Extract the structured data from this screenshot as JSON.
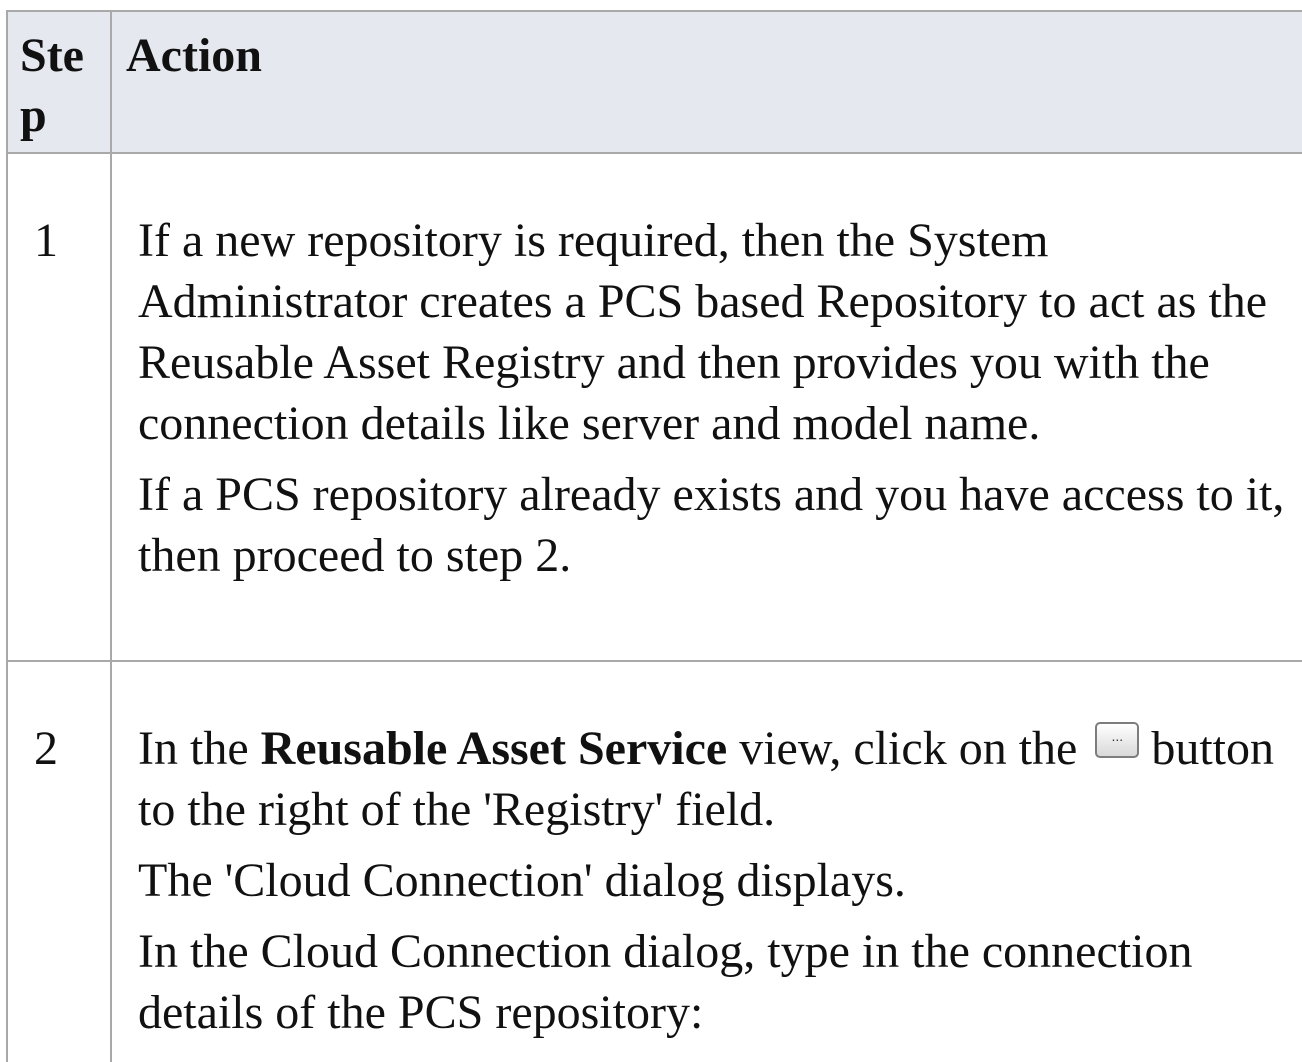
{
  "table": {
    "header": {
      "step": "Step",
      "action": "Action"
    },
    "rows": [
      {
        "step": "1",
        "paragraphs": [
          "If a new repository is required, then the System Administrator creates a PCS based Repository to act as the Reusable Asset Registry and then provides you with the connection details like server and model name.",
          "If a PCS repository already exists and you have access to it, then proceed to step 2."
        ]
      },
      {
        "step": "2",
        "intro_before": "In the ",
        "intro_bold": "Reusable Asset Service",
        "intro_after": " view, click on the",
        "intro_rest": "button to the right of the 'Registry' field.",
        "button_icon": "ellipsis-button-icon",
        "paragraphs": [
          "The 'Cloud Connection' dialog displays.",
          "In the Cloud Connection dialog, type in the connection details of the PCS repository:"
        ]
      }
    ]
  }
}
